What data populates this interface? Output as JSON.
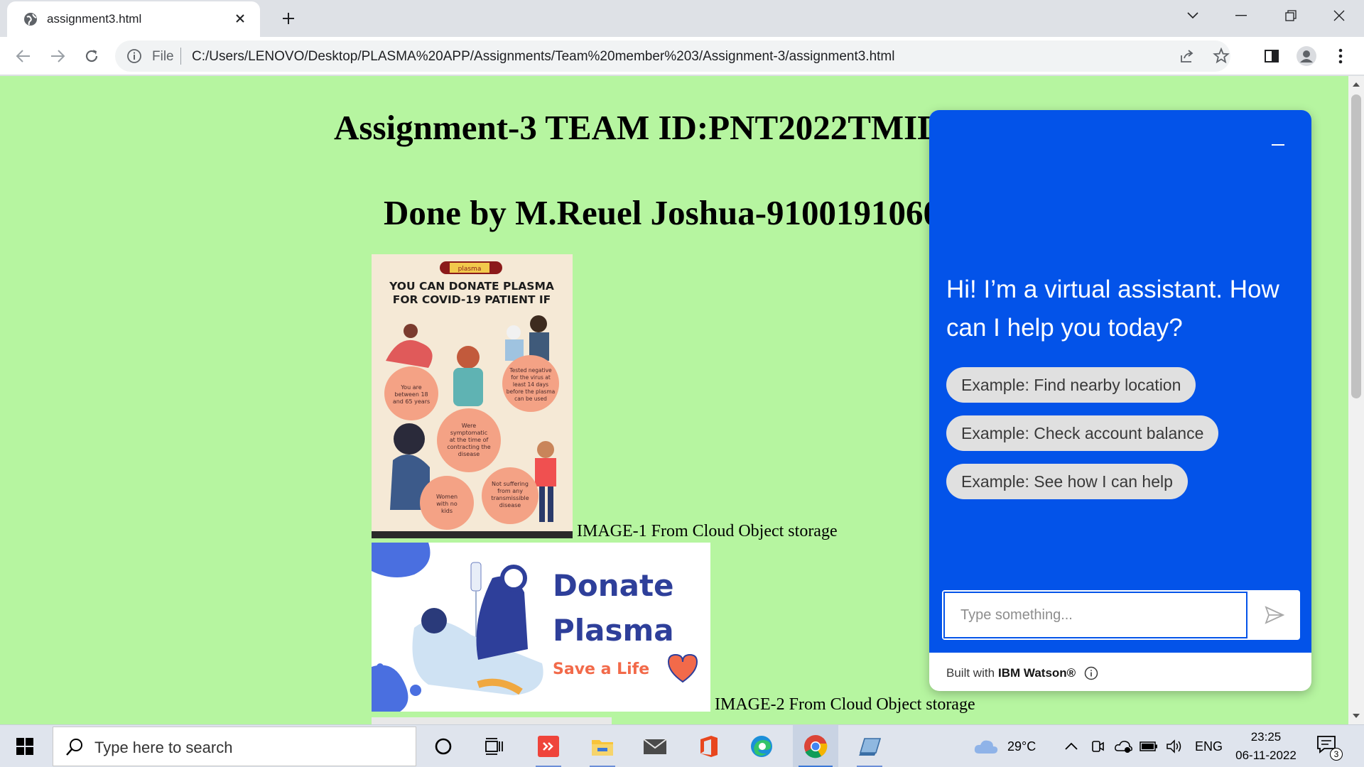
{
  "browser": {
    "tab_title": "assignment3.html",
    "address_scheme": "File",
    "address_url": "C:/Users/LENOVO/Desktop/PLASMA%20APP/Assignments/Team%20member%203/Assignment-3/assignment3.html"
  },
  "page": {
    "heading_1": "Assignment-3 TEAM ID:PNT2022TMID",
    "heading_2": "Done by M.Reuel Joshua-9100191060",
    "image1": {
      "caption": "IMAGE-1 From Cloud Object storage",
      "tube_label": "plasma",
      "headline_1": "YOU CAN DONATE PLASMA",
      "headline_2": "FOR COVID-19 PATIENT IF",
      "bubble_age": "You are between 18 and 65 years",
      "bubble_tested": "Tested negative for the virus at least 14 days before the plasma can be used",
      "bubble_symptomatic": "Were symptomatic at the time of contracting the disease",
      "bubble_women": "Women with no kids",
      "bubble_disease": "Not suffering from any transmissible disease"
    },
    "image2": {
      "caption": "IMAGE-2 From Cloud Object storage",
      "word_1": "Donate",
      "word_2": "Plasma",
      "tagline": "Save a Life"
    }
  },
  "chat": {
    "greeting": "Hi! I’m a virtual assistant. How can I help you today?",
    "chips": [
      "Example: Find nearby location",
      "Example: Check account balance",
      "Example: See how I can help"
    ],
    "input_placeholder": "Type something...",
    "footer_prefix": "Built with",
    "footer_brand": "IBM Watson®"
  },
  "taskbar": {
    "search_placeholder": "Type here to search",
    "temperature": "29°C",
    "language": "ENG",
    "time": "23:25",
    "date": "06-11-2022",
    "notification_count": "3"
  },
  "colors": {
    "page_background": "#b6f5a0",
    "chat_blue": "#0353e9",
    "chip_gray": "#e0e0e0"
  }
}
